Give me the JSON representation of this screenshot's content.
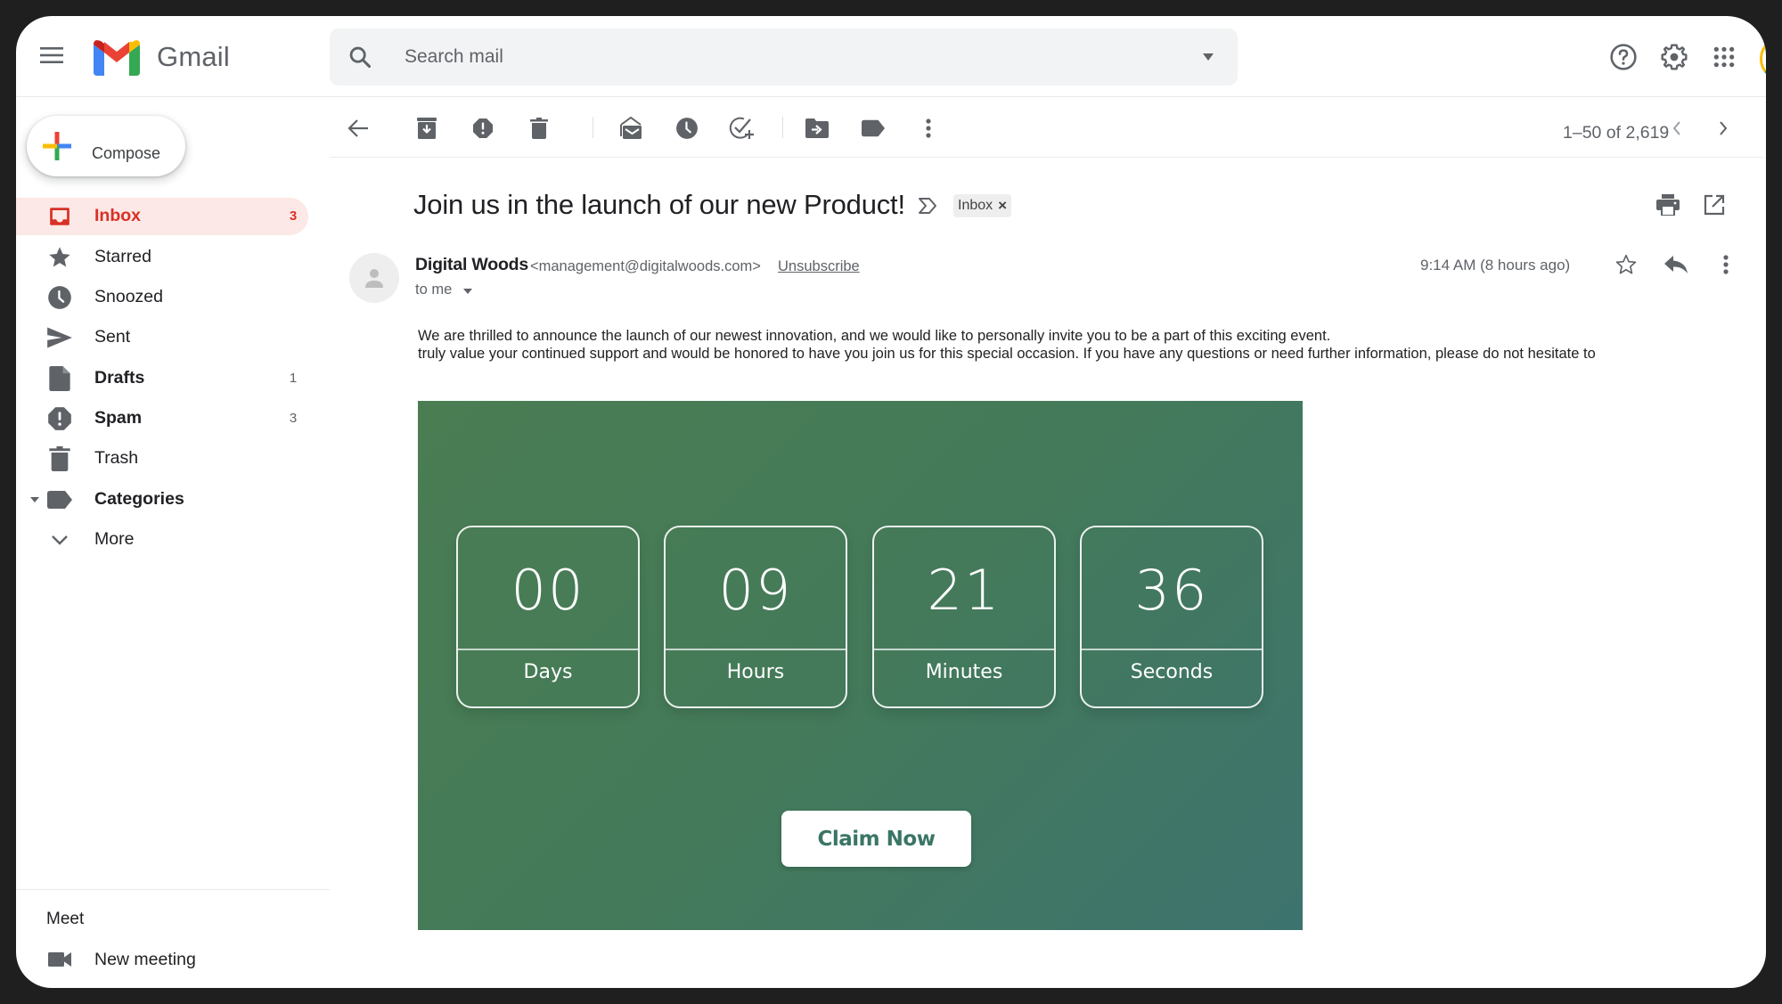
{
  "app": {
    "name": "Gmail"
  },
  "search": {
    "placeholder": "Search mail"
  },
  "sidebar": {
    "compose_label": "Compose",
    "items": [
      {
        "label": "Inbox",
        "count": "3",
        "icon": "inbox-icon",
        "active": true,
        "bold": true
      },
      {
        "label": "Starred",
        "count": "",
        "icon": "star-icon",
        "active": false,
        "bold": false
      },
      {
        "label": "Snoozed",
        "count": "",
        "icon": "clock-icon",
        "active": false,
        "bold": false
      },
      {
        "label": "Sent",
        "count": "",
        "icon": "send-icon",
        "active": false,
        "bold": false
      },
      {
        "label": "Drafts",
        "count": "1",
        "icon": "draft-icon",
        "active": false,
        "bold": true
      },
      {
        "label": "Spam",
        "count": "3",
        "icon": "spam-icon",
        "active": false,
        "bold": true
      },
      {
        "label": "Trash",
        "count": "",
        "icon": "trash-icon",
        "active": false,
        "bold": false
      },
      {
        "label": "Categories",
        "count": "",
        "icon": "label-icon",
        "active": false,
        "bold": true
      },
      {
        "label": "More",
        "count": "",
        "icon": "chevron-down-icon",
        "active": false,
        "bold": false
      }
    ],
    "meet": {
      "title": "Meet",
      "new_meeting": "New meeting"
    }
  },
  "toolbar": {
    "actions": [
      "back",
      "archive",
      "report-spam",
      "delete",
      "mark-unread",
      "snooze",
      "add-to-tasks",
      "move-to",
      "labels",
      "more"
    ],
    "pagination": "1–50 of 2,619"
  },
  "message": {
    "subject": "Join us in the launch of our new Product!",
    "label_chip": "Inbox",
    "label_chip_remove": "×",
    "sender_name": "Digital Woods",
    "sender_email": "<management@digitalwoods.com>",
    "unsubscribe": "Unsubscribe",
    "recipient": "to me",
    "timestamp": "9:14 AM (8 hours ago)",
    "body_lines": [
      "We are thrilled to announce the launch of our newest innovation, and we would like to personally invite you to be a part of this exciting event.",
      "truly value your continued support and would be honored to have you join us for this special occasion. If you have any questions or need further information, please do not hesitate to"
    ],
    "banner": {
      "countdown": [
        {
          "value": "00",
          "label": "Days"
        },
        {
          "value": "09",
          "label": "Hours"
        },
        {
          "value": "21",
          "label": "Minutes"
        },
        {
          "value": "36",
          "label": "Seconds"
        }
      ],
      "cta_label": "Claim Now",
      "colors": {
        "gradient_start": "#4a7d52",
        "gradient_end": "#3d736e",
        "cta_text": "#3a7565"
      }
    }
  },
  "colors": {
    "accent_red": "#d93025",
    "active_bg": "#fce8e6",
    "icon_gray": "#5f6368"
  }
}
